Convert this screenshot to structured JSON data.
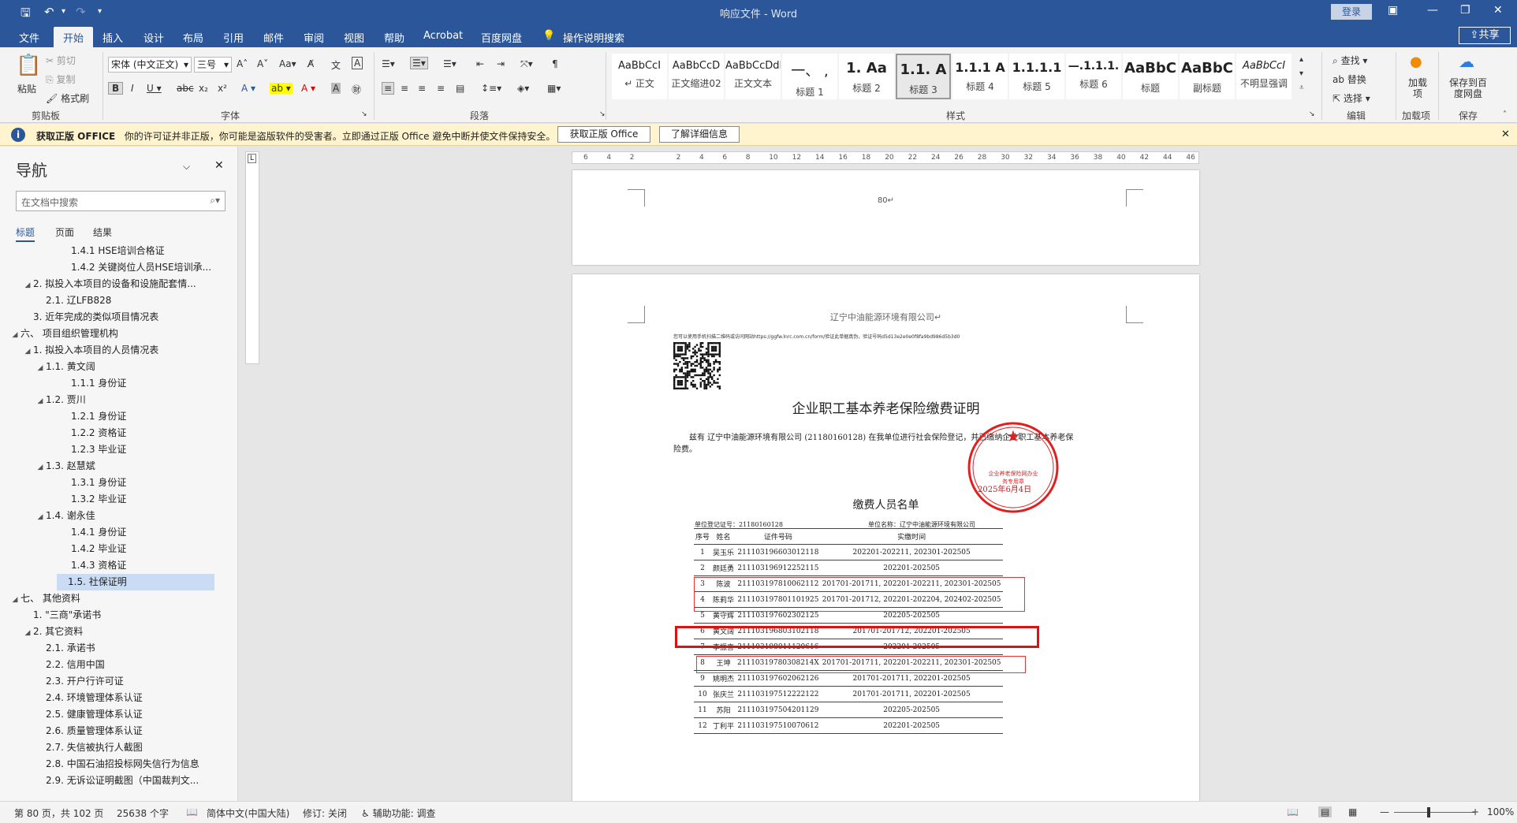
{
  "window": {
    "title": "响应文件 - Word",
    "login": "登录",
    "share": "共享"
  },
  "tabs": [
    "文件",
    "开始",
    "插入",
    "设计",
    "布局",
    "引用",
    "邮件",
    "审阅",
    "视图",
    "帮助",
    "Acrobat",
    "百度网盘",
    "操作说明搜索"
  ],
  "ribbon": {
    "clipboard": {
      "paste": "粘贴",
      "cut": "剪切",
      "copy": "复制",
      "format_painter": "格式刷",
      "label": "剪贴板"
    },
    "font": {
      "name": "宋体 (中文正文)",
      "size": "三号",
      "label": "字体"
    },
    "paragraph": {
      "label": "段落"
    },
    "styles": {
      "label": "样式",
      "items": [
        {
          "sample": "AaBbCcI",
          "name": "↵ 正文"
        },
        {
          "sample": "AaBbCcD",
          "name": "正文缩进02"
        },
        {
          "sample": "AaBbCcDdI",
          "name": "正文文本"
        },
        {
          "sample": "一、 ,",
          "name": "标题 1"
        },
        {
          "sample": "1. Aa",
          "name": "标题 2"
        },
        {
          "sample": "1.1. A",
          "name": "标题 3"
        },
        {
          "sample": "1.1.1 A",
          "name": "标题 4"
        },
        {
          "sample": "1.1.1.1",
          "name": "标题 5"
        },
        {
          "sample": "—.1.1.1.",
          "name": "标题 6"
        },
        {
          "sample": "AaBbC",
          "name": "标题"
        },
        {
          "sample": "AaBbC",
          "name": "副标题"
        },
        {
          "sample": "AaBbCcI",
          "name": "不明显强调"
        }
      ]
    },
    "editing": {
      "find": "查找",
      "replace": "替换",
      "select": "选择",
      "label": "编辑"
    },
    "addin": {
      "name": "加载项",
      "label": "加载项"
    },
    "save_baidu": {
      "name": "保存到百度网盘",
      "label": "保存"
    }
  },
  "infobar": {
    "title": "获取正版 OFFICE",
    "message": "你的许可证并非正版，你可能是盗版软件的受害者。立即通过正版 Office 避免中断并使文件保持安全。",
    "btn_get": "获取正版 Office",
    "btn_more": "了解详细信息"
  },
  "nav": {
    "title": "导航",
    "search_placeholder": "在文档中搜索",
    "tabs": [
      "标题",
      "页面",
      "结果"
    ],
    "items": [
      {
        "indent": 5,
        "toggle": "",
        "text": "1.4.1 HSE培训合格证"
      },
      {
        "indent": 5,
        "toggle": "",
        "text": "1.4.2 关键岗位人员HSE培训承..."
      },
      {
        "indent": 2,
        "toggle": "◢",
        "text": "2. 拟投入本项目的设备和设施配套情..."
      },
      {
        "indent": 3,
        "toggle": "",
        "text": "2.1. 辽LFB828"
      },
      {
        "indent": 2,
        "toggle": "",
        "text": "3. 近年完成的类似项目情况表"
      },
      {
        "indent": 1,
        "toggle": "◢",
        "text": "六、 项目组织管理机构"
      },
      {
        "indent": 2,
        "toggle": "◢",
        "text": "1. 拟投入本项目的人员情况表"
      },
      {
        "indent": 3,
        "toggle": "◢",
        "text": "1.1. 黄文阔"
      },
      {
        "indent": 5,
        "toggle": "",
        "text": "1.1.1 身份证"
      },
      {
        "indent": 3,
        "toggle": "◢",
        "text": "1.2. 贾川"
      },
      {
        "indent": 5,
        "toggle": "",
        "text": "1.2.1 身份证"
      },
      {
        "indent": 5,
        "toggle": "",
        "text": "1.2.2 资格证"
      },
      {
        "indent": 5,
        "toggle": "",
        "text": "1.2.3 毕业证"
      },
      {
        "indent": 3,
        "toggle": "◢",
        "text": "1.3. 赵慧斌"
      },
      {
        "indent": 5,
        "toggle": "",
        "text": "1.3.1 身份证"
      },
      {
        "indent": 5,
        "toggle": "",
        "text": "1.3.2 毕业证"
      },
      {
        "indent": 3,
        "toggle": "◢",
        "text": "1.4. 谢永佳"
      },
      {
        "indent": 5,
        "toggle": "",
        "text": "1.4.1 身份证"
      },
      {
        "indent": 5,
        "toggle": "",
        "text": "1.4.2 毕业证"
      },
      {
        "indent": 5,
        "toggle": "",
        "text": "1.4.3 资格证"
      },
      {
        "indent": 4,
        "toggle": "",
        "text": "1.5. 社保证明",
        "selected": true
      },
      {
        "indent": 1,
        "toggle": "◢",
        "text": "七、 其他资料"
      },
      {
        "indent": 2,
        "toggle": "",
        "text": "1. \"三商\"承诺书"
      },
      {
        "indent": 2,
        "toggle": "◢",
        "text": "2. 其它资料"
      },
      {
        "indent": 3,
        "toggle": "",
        "text": "2.1. 承诺书"
      },
      {
        "indent": 3,
        "toggle": "",
        "text": "2.2. 信用中国"
      },
      {
        "indent": 3,
        "toggle": "",
        "text": "2.3. 开户行许可证"
      },
      {
        "indent": 3,
        "toggle": "",
        "text": "2.4. 环境管理体系认证"
      },
      {
        "indent": 3,
        "toggle": "",
        "text": "2.5. 健康管理体系认证"
      },
      {
        "indent": 3,
        "toggle": "",
        "text": "2.6. 质量管理体系认证"
      },
      {
        "indent": 3,
        "toggle": "",
        "text": "2.7. 失信被执行人截图"
      },
      {
        "indent": 3,
        "toggle": "",
        "text": "2.8. 中国石油招投标网失信行为信息"
      },
      {
        "indent": 3,
        "toggle": "",
        "text": "2.9. 无诉讼证明截图（中国裁判文..."
      }
    ]
  },
  "ruler": {
    "ticks": [
      "6",
      "4",
      "2",
      "",
      "2",
      "4",
      "6",
      "8",
      "10",
      "12",
      "14",
      "16",
      "18",
      "20",
      "22",
      "24",
      "26",
      "28",
      "30",
      "32",
      "34",
      "36",
      "38",
      "40",
      "42",
      "44",
      "46"
    ]
  },
  "document": {
    "page_number": "80↵",
    "header_company": "辽宁中油能源环境有限公司↵",
    "verify_text": "您可以使用手机扫描二维码或访问网站https://ggfw.lnrc.com.cn/form/验证此单据真伪，验证号码d5d13e2e0e0f8fa9bd986d5b3d0",
    "doc_title": "企业职工基本养老保险缴费证明",
    "body_text": "兹有 辽宁中油能源环境有限公司 (21180160128) 在我单位进行社会保险登记，并已缴纳企业职工基本养老保险费。",
    "date": "2025年6月4日",
    "seal_text": "企业养老保险网办业务专用章",
    "list_title": "缴费人员名单",
    "unit_code": "单位登记证号：21180160128",
    "unit_name": "单位名称：辽宁中油能源环境有限公司",
    "table": {
      "headers": [
        "序号",
        "姓名",
        "证件号码",
        "实缴时间"
      ],
      "rows": [
        [
          "1",
          "吴玉乐",
          "211103196603012118",
          "202201-202211, 202301-202505"
        ],
        [
          "2",
          "颜廷勇",
          "211103196912252115",
          "202201-202505"
        ],
        [
          "3",
          "陈波",
          "211103197810062112",
          "201701-201711, 202201-202211, 202301-202505"
        ],
        [
          "4",
          "陈莉华",
          "211103197801101925",
          "201701-201712, 202201-202204, 202402-202505"
        ],
        [
          "5",
          "黄守辉",
          "211103197602302125",
          "202205-202505"
        ],
        [
          "6",
          "黄文阔",
          "211103196803102118",
          "201701-201712, 202201-202505"
        ],
        [
          "7",
          "李振喜",
          "211103198011120616",
          "202201-202505"
        ],
        [
          "8",
          "王坤",
          "21110319780308214X",
          "201701-201711, 202201-202211, 202301-202505"
        ],
        [
          "9",
          "姚明杰",
          "211103197602062126",
          "201701-201711, 202201-202505"
        ],
        [
          "10",
          "张庆兰",
          "211103197512222122",
          "201701-201711, 202201-202505"
        ],
        [
          "11",
          "苏阳",
          "211103197504201129",
          "202205-202505"
        ],
        [
          "12",
          "丁利平",
          "211103197510070612",
          "202201-202505"
        ]
      ]
    }
  },
  "status": {
    "page": "第 80 页，共 102 页",
    "words": "25638 个字",
    "language": "简体中文(中国大陆)",
    "track": "修订: 关闭",
    "accessibility": "辅助功能: 调查",
    "zoom": "100%"
  },
  "colors": {
    "brand": "#2b579a",
    "seal": "#e02020",
    "highlight": "#e33"
  }
}
